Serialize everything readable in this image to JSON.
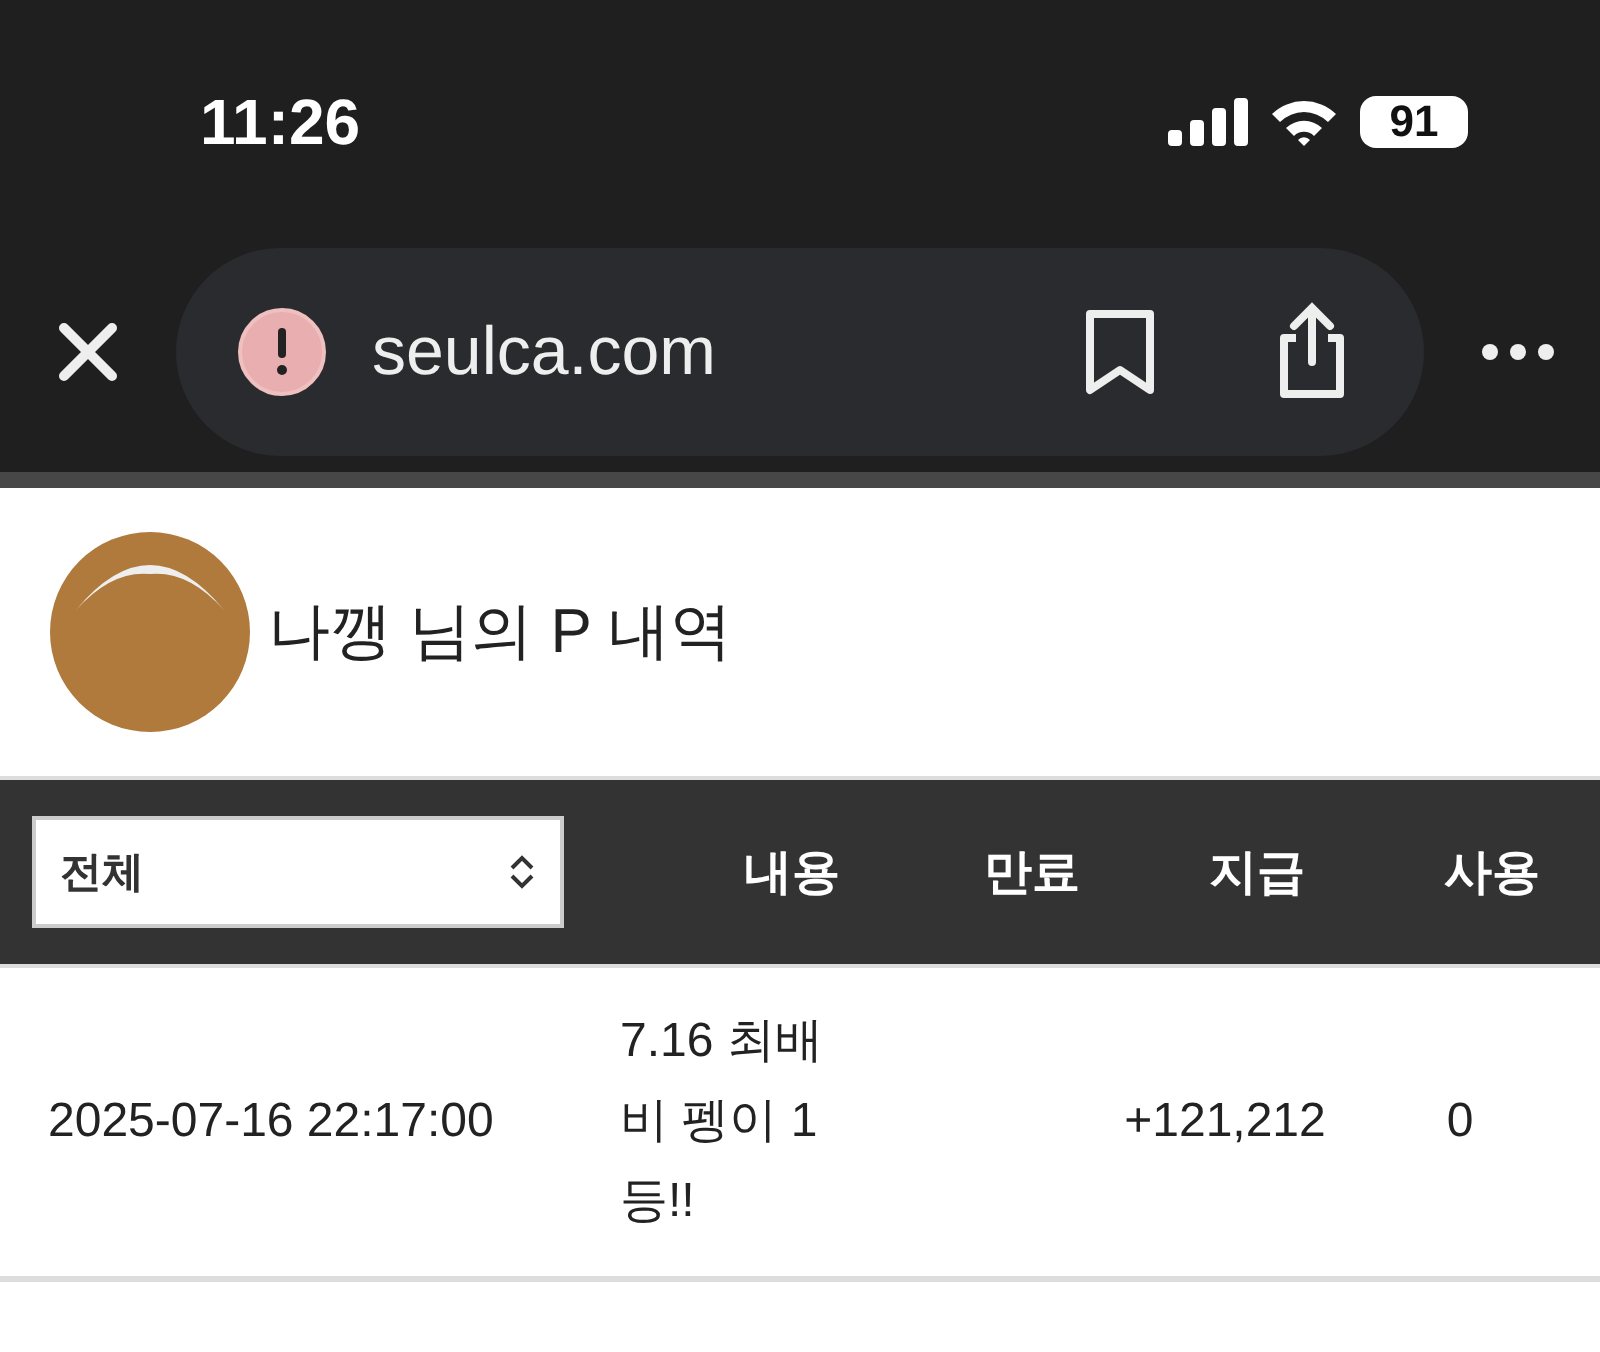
{
  "status_bar": {
    "time": "11:26",
    "battery": "91"
  },
  "browser": {
    "url": "seulca.com"
  },
  "profile": {
    "title": "나깽 님의 P 내역"
  },
  "table": {
    "filter": {
      "value": "전체"
    },
    "columns": [
      "내용",
      "만료",
      "지급",
      "사용"
    ],
    "rows": [
      {
        "date": "2025-07-16 22:17:00",
        "content": "7.16 최배비 펭이 1등!!",
        "expiry": "",
        "given": "+121,212",
        "used": "0"
      }
    ]
  }
}
